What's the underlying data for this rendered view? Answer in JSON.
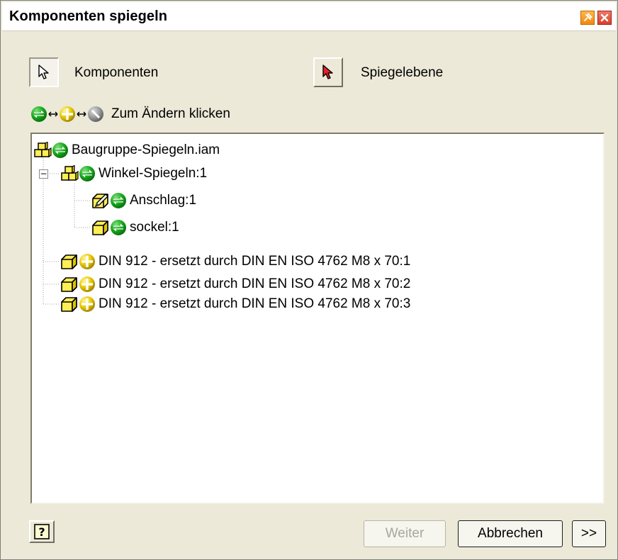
{
  "window": {
    "title": "Komponenten spiegeln"
  },
  "selectors": {
    "components_label": "Komponenten",
    "mirror_plane_label": "Spiegelebene"
  },
  "status": {
    "text": "Zum Ändern klicken"
  },
  "tree": {
    "root": {
      "label": "Baugruppe-Spiegeln.iam",
      "icon": "assembly-icon",
      "status": "mirror-green"
    },
    "items": [
      {
        "label": "Winkel-Spiegeln:1",
        "icon": "assembly-icon",
        "status": "mirror-green",
        "expanded": true,
        "expander": "−"
      },
      {
        "label": "Anschlag:1",
        "icon": "pencil-part-icon",
        "status": "mirror-green"
      },
      {
        "label": "sockel:1",
        "icon": "part-icon",
        "status": "mirror-green"
      },
      {
        "label": "DIN 912  - ersetzt durch DIN EN ISO 4762 M8 x 70:1",
        "icon": "part-icon",
        "status": "reuse-yellow"
      },
      {
        "label": "DIN 912  - ersetzt durch DIN EN ISO 4762 M8 x 70:2",
        "icon": "part-icon",
        "status": "reuse-yellow"
      },
      {
        "label": "DIN 912  - ersetzt durch DIN EN ISO 4762 M8 x 70:3",
        "icon": "part-icon",
        "status": "reuse-yellow"
      }
    ]
  },
  "buttons": {
    "help": "?",
    "next": "Weiter",
    "cancel": "Abbrechen",
    "more": ">>"
  },
  "colors": {
    "mirror_green": "#129d1c",
    "reuse_yellow": "#e0c000",
    "exclude_gray": "#8a8a8a",
    "dialog_bg": "#ece9d8"
  }
}
